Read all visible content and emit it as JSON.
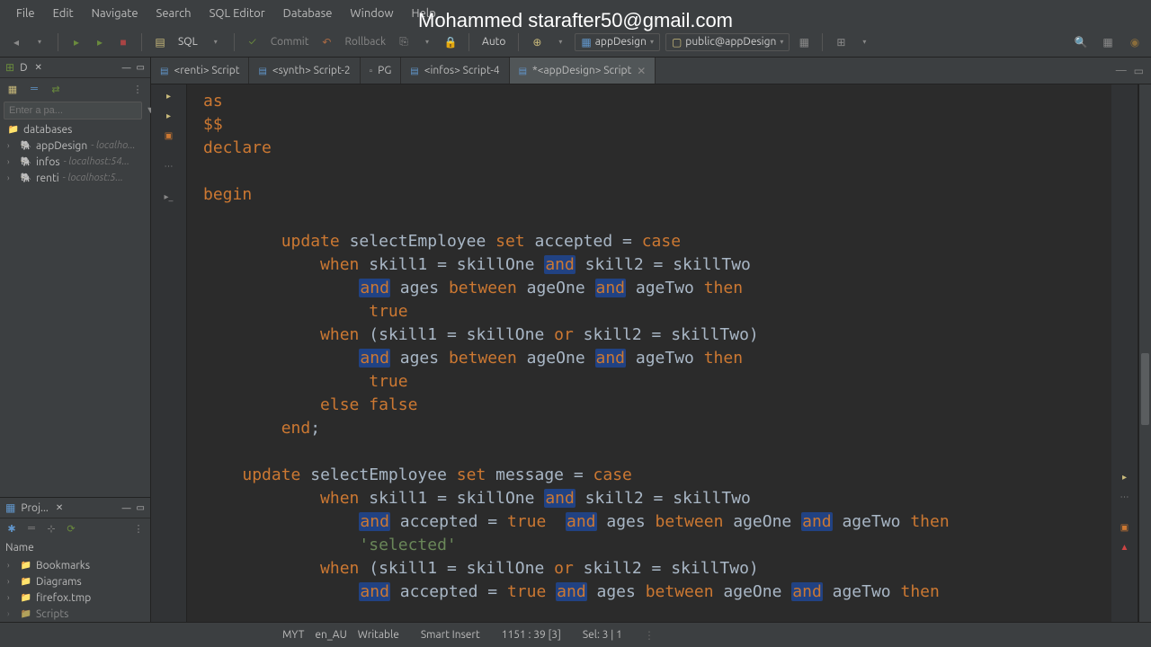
{
  "menubar": [
    "File",
    "Edit",
    "Navigate",
    "Search",
    "SQL Editor",
    "Database",
    "Window",
    "Help"
  ],
  "watermark": "Mohammed starafter50@gmail.com",
  "toolbar": {
    "sql_label": "SQL",
    "commit_label": "Commit",
    "rollback_label": "Rollback",
    "auto_label": "Auto",
    "db_dropdown": "appDesign",
    "schema_dropdown": "public@appDesign"
  },
  "db_panel": {
    "tab_label": "D",
    "filter_placeholder": "Enter a pa...",
    "root": "databases",
    "items": [
      {
        "name": "appDesign",
        "host": "- localho..."
      },
      {
        "name": "infos",
        "host": "- localhost:54..."
      },
      {
        "name": "renti",
        "host": "- localhost:5..."
      }
    ]
  },
  "proj_panel": {
    "tab_label": "Proj...",
    "name_header": "Name",
    "items": [
      "Bookmarks",
      "Diagrams",
      "firefox.tmp",
      "Scripts"
    ]
  },
  "editor_tabs": [
    {
      "label": "<renti> Script",
      "active": false
    },
    {
      "label": "<synth> Script-2",
      "active": false
    },
    {
      "label": "PG",
      "active": false,
      "icon": "doc"
    },
    {
      "label": "<infos> Script-4",
      "active": false
    },
    {
      "label": "*<appDesign> Script",
      "active": true,
      "close": true
    }
  ],
  "code_lines": [
    {
      "i": 0,
      "t": "as",
      "cls": "kw-orange"
    },
    {
      "i": 0,
      "t": "$$",
      "cls": "kw-orange"
    },
    {
      "i": 0,
      "t": "declare",
      "cls": "kw-orange"
    },
    {
      "i": 0,
      "t": "",
      "cls": ""
    },
    {
      "i": 0,
      "t": "begin",
      "cls": "kw-orange"
    },
    {
      "i": 0,
      "t": "",
      "cls": ""
    }
  ],
  "status": {
    "tz": "MYT",
    "locale": "en_AU",
    "mode": "Writable",
    "insert": "Smart Insert",
    "pos": "1151 : 39 [3]",
    "sel": "Sel: 3 | 1"
  }
}
